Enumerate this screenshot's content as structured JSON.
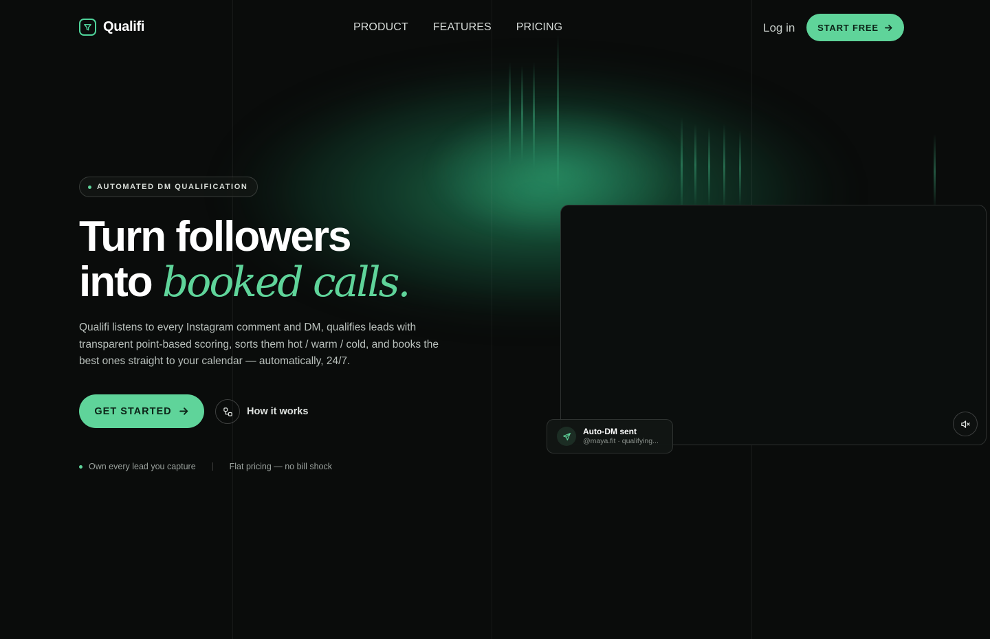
{
  "brand": {
    "name": "Qualifi",
    "accent": "#5fd49a"
  },
  "nav": {
    "links": [
      "PRODUCT",
      "FEATURES",
      "PRICING"
    ],
    "login": "Log in",
    "start_free": "START FREE"
  },
  "hero": {
    "badge": "AUTOMATED DM QUALIFICATION",
    "headline_line1": "Turn followers",
    "headline_into": "into",
    "headline_accent": "booked calls.",
    "lead": "Qualifi listens to every Instagram comment and DM, qualifies leads with transparent point-based scoring, sorts them hot / warm / cold, and books the best ones straight to your calendar — automatically, 24/7.",
    "cta_primary": "GET STARTED",
    "cta_secondary": "How it works",
    "trust": [
      "Own every lead you capture",
      "Flat pricing — no bill shock"
    ]
  },
  "video": {
    "toast_title": "Auto-DM sent",
    "toast_sub": "@maya.fit · qualifying...",
    "mute_icon": "speaker-muted-icon"
  }
}
